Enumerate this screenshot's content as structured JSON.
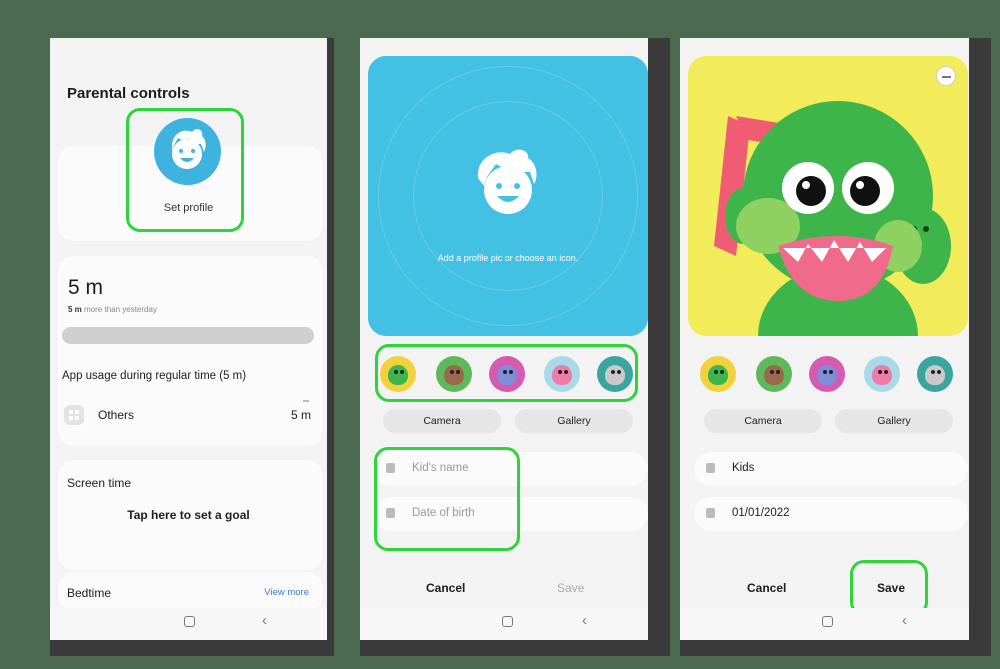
{
  "screen1": {
    "title": "Parental controls",
    "set_profile": "Set profile",
    "usage_value": "5 m",
    "usage_sub_bold": "5 m",
    "usage_sub_rest": " more than yesterday",
    "regular_time_label": "App usage during regular time (5 m)",
    "others_label": "Others",
    "others_value": "5 m",
    "screen_time_label": "Screen time",
    "goal_label": "Tap here to set a goal",
    "bedtime_label": "Bedtime",
    "view_more": "View more"
  },
  "screen2": {
    "hero_hint": "Add a profile pic or choose an icon.",
    "camera": "Camera",
    "gallery": "Gallery",
    "name_placeholder": "Kid's name",
    "dob_placeholder": "Date of birth",
    "cancel": "Cancel",
    "save": "Save"
  },
  "screen3": {
    "camera": "Camera",
    "gallery": "Gallery",
    "name_value": "Kids",
    "dob_value": "01/01/2022",
    "cancel": "Cancel",
    "save": "Save"
  },
  "icon_options": [
    "dinosaur-icon",
    "sloth-icon",
    "walrus-icon",
    "pig-icon",
    "koala-icon"
  ],
  "colors": {
    "highlight": "#2fd43a",
    "hero_blue": "#43c1e5",
    "hero_yellow": "#f3ec5a",
    "dino_green": "#3db54a",
    "link_blue": "#3b7bd1"
  }
}
